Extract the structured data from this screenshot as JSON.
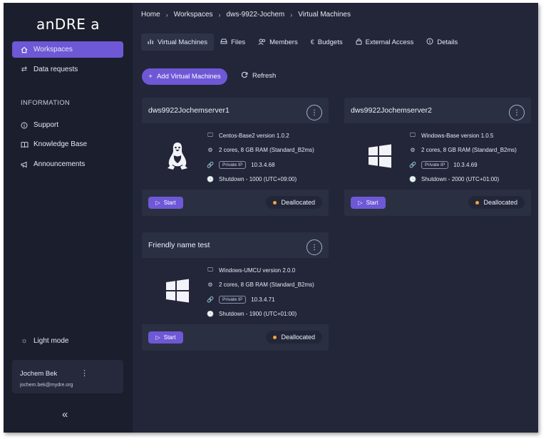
{
  "app": {
    "logo": "anDRE a"
  },
  "sidebar": {
    "items": [
      {
        "label": "Workspaces",
        "icon": "home-icon",
        "active": true
      },
      {
        "label": "Data requests",
        "icon": "swap-icon",
        "active": false
      }
    ],
    "section_title": "INFORMATION",
    "info_items": [
      {
        "label": "Support",
        "icon": "info-icon"
      },
      {
        "label": "Knowledge Base",
        "icon": "book-icon"
      },
      {
        "label": "Announcements",
        "icon": "megaphone-icon"
      }
    ],
    "light_mode_label": "Light mode",
    "user": {
      "name": "Jochem Bek",
      "email": "jochem.bek@mydre.org"
    },
    "collapse_glyph": "«"
  },
  "breadcrumb": [
    "Home",
    "Workspaces",
    "dws-9922-Jochem",
    "Virtual Machines"
  ],
  "tabs": [
    {
      "label": "Virtual Machines",
      "icon": "bar-chart-icon",
      "active": true
    },
    {
      "label": "Files",
      "icon": "drive-icon",
      "active": false
    },
    {
      "label": "Members",
      "icon": "users-icon",
      "active": false
    },
    {
      "label": "Budgets",
      "icon": "euro-icon",
      "active": false
    },
    {
      "label": "External Access",
      "icon": "lock-icon",
      "active": false
    },
    {
      "label": "Details",
      "icon": "info-icon",
      "active": false
    }
  ],
  "actions": {
    "add_label": "Add Virtual Machines",
    "refresh_label": "Refresh"
  },
  "badge_label": "Private IP",
  "start_label": "Start",
  "colors": {
    "accent": "#6e58d6",
    "status_dot": "#f3a43b",
    "background": "#222638",
    "sidebar": "#1b1e2c"
  },
  "vms": [
    {
      "name": "dws9922Jochemserver1",
      "os": "linux",
      "image": "Centos-Base2 version 1.0.2",
      "size": "2 cores, 8 GB RAM (Standard_B2ms)",
      "ip": "10.3.4.68",
      "shutdown": "Shutdown - 1000 (UTC+09:00)",
      "status": "Deallocated"
    },
    {
      "name": "dws9922Jochemserver2",
      "os": "windows",
      "image": "Windows-Base version 1.0.5",
      "size": "2 cores, 8 GB RAM (Standard_B2ms)",
      "ip": "10.3.4.69",
      "shutdown": "Shutdown - 2000 (UTC+01:00)",
      "status": "Deallocated"
    },
    {
      "name": "Friendly name test",
      "os": "windows",
      "image": "Windows-UMCU version 2.0.0",
      "size": "2 cores, 8 GB RAM (Standard_B2ms)",
      "ip": "10.3.4.71",
      "shutdown": "Shutdown - 1900 (UTC+01:00)",
      "status": "Deallocated"
    }
  ]
}
